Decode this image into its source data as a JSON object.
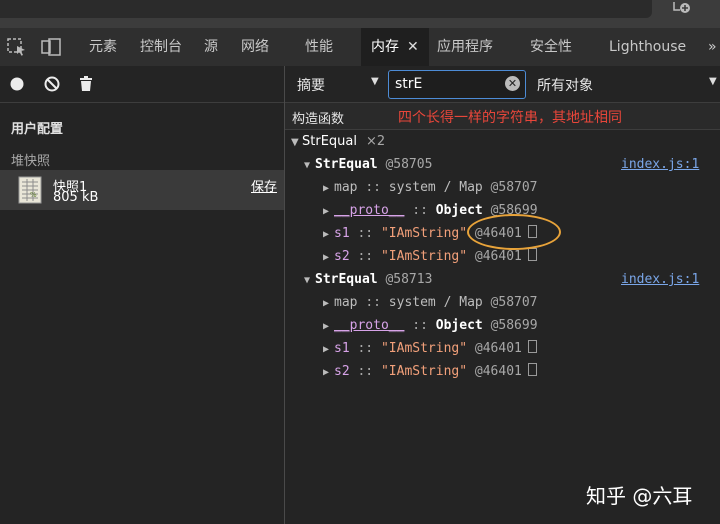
{
  "tabs": [
    {
      "label": "元素"
    },
    {
      "label": "控制台"
    },
    {
      "label": "源"
    },
    {
      "label": "网络"
    },
    {
      "label": "性能"
    },
    {
      "label": "内存",
      "active": true
    },
    {
      "label": "应用程序"
    },
    {
      "label": "安全性"
    },
    {
      "label": "Lighthouse"
    }
  ],
  "tab_close": "✕",
  "tab_more": "»",
  "left": {
    "profiles_title": "用户配置",
    "heap_section": "堆快照",
    "snapshot": {
      "name": "快照1",
      "size": "805 kB",
      "save": "保存"
    }
  },
  "right": {
    "view": "摘要",
    "filter_value": "strE",
    "class_filter": "所有对象",
    "column_constructor": "构造函数",
    "annotation": "四个长得一样的字符串，其地址相同",
    "group": {
      "name": "StrEqual",
      "count": "×2"
    },
    "instances": [
      {
        "name": "StrEqual",
        "addr": "@58705",
        "source": "index.js:1",
        "fields": [
          {
            "key": "map",
            "sep": "::",
            "value": "system / Map",
            "addr": "@58707"
          },
          {
            "key": "__proto__",
            "sep": "::",
            "value": "Object",
            "addr": "@58699"
          },
          {
            "key": "s1",
            "sep": "::",
            "value": "\"IAmString\"",
            "addr": "@46401"
          },
          {
            "key": "s2",
            "sep": "::",
            "value": "\"IAmString\"",
            "addr": "@46401"
          }
        ]
      },
      {
        "name": "StrEqual",
        "addr": "@58713",
        "source": "index.js:1",
        "fields": [
          {
            "key": "map",
            "sep": "::",
            "value": "system / Map",
            "addr": "@58707"
          },
          {
            "key": "__proto__",
            "sep": "::",
            "value": "Object",
            "addr": "@58699"
          },
          {
            "key": "s1",
            "sep": "::",
            "value": "\"IAmString\"",
            "addr": "@46401"
          },
          {
            "key": "s2",
            "sep": "::",
            "value": "\"IAmString\"",
            "addr": "@46401"
          }
        ]
      }
    ]
  },
  "watermark": "知乎 @六耳",
  "colors": {
    "accent_blue": "#4d8cd6",
    "annotation_red": "#e8463a",
    "highlight_orange": "#e8a33a"
  }
}
